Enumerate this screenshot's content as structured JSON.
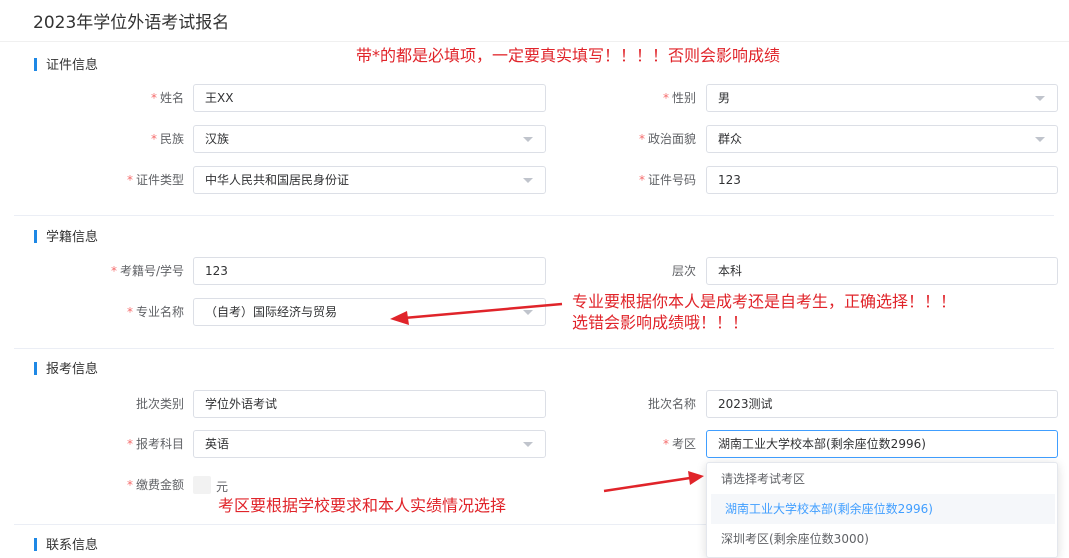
{
  "page_title": "2023年学位外语考试报名",
  "annotations": {
    "required_notice": "带*的都是必填项，一定要真实填写！！！！否则会影响成绩",
    "major_note_line1": "专业要根据你本人是成考还是自考生，正确选择！！！",
    "major_note_line2": "选错会影响成绩哦！！！",
    "exam_area_note": "考区要根据学校要求和本人实绩情况选择"
  },
  "required_mark": "*",
  "sections": {
    "id_info": {
      "title": "证件信息",
      "name": {
        "label": "姓名",
        "value": "王XX"
      },
      "gender": {
        "label": "性别",
        "value": "男"
      },
      "ethnicity": {
        "label": "民族",
        "value": "汉族"
      },
      "political_status": {
        "label": "政治面貌",
        "value": "群众"
      },
      "id_type": {
        "label": "证件类型",
        "value": "中华人民共和国居民身份证"
      },
      "id_number": {
        "label": "证件号码",
        "value": "123"
      }
    },
    "student_info": {
      "title": "学籍信息",
      "student_no": {
        "label": "考籍号/学号",
        "value": "123"
      },
      "level": {
        "label": "层次",
        "value": "本科"
      },
      "major": {
        "label": "专业名称",
        "value": "（自考）国际经济与贸易"
      }
    },
    "exam_info": {
      "title": "报考信息",
      "batch_type": {
        "label": "批次类别",
        "value": "学位外语考试"
      },
      "batch_name": {
        "label": "批次名称",
        "value": "2023测试"
      },
      "subject": {
        "label": "报考科目",
        "value": "英语"
      },
      "exam_area": {
        "label": "考区",
        "value": "湖南工业大学校本部(剩余座位数2996)"
      },
      "fee": {
        "label": "缴费金额",
        "unit": "元"
      }
    },
    "contact_info": {
      "title": "联系信息"
    }
  },
  "exam_area_dropdown": {
    "options": [
      "请选择考试考区",
      "湖南工业大学校本部(剩余座位数2996)",
      "深圳考区(剩余座位数3000)"
    ],
    "selected": "湖南工业大学校本部(剩余座位数2996)"
  },
  "colors": {
    "accent": "#1e88e5",
    "required": "#f56c6c",
    "annotation": "#e0242a",
    "selected_option": "#409eff"
  }
}
